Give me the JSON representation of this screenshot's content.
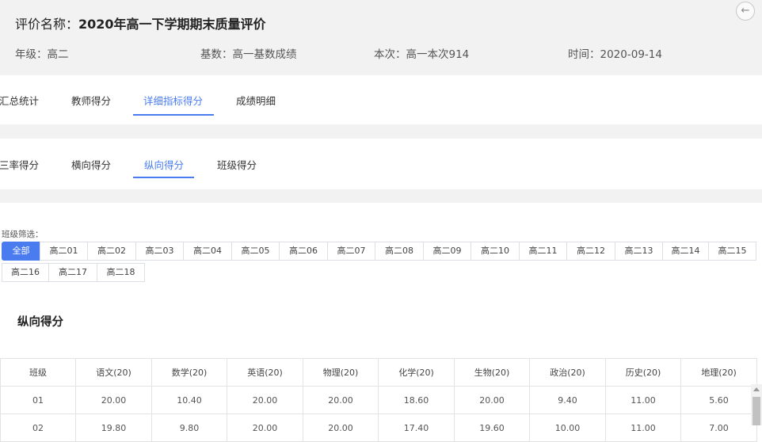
{
  "header": {
    "title_label": "评价名称：",
    "title_value": "2020年高一下学期期末质量评价",
    "grade": "年级：高二",
    "base": "基数：高一基数成绩",
    "current": "本次：高一本次914",
    "time": "时间：2020-09-14",
    "back_icon": "arrow-left-icon",
    "back_glyph": "←"
  },
  "main_tabs": [
    {
      "label": "汇总统计",
      "active": false
    },
    {
      "label": "教师得分",
      "active": false
    },
    {
      "label": "详细指标得分",
      "active": true
    },
    {
      "label": "成绩明细",
      "active": false
    }
  ],
  "sub_tabs": [
    {
      "label": "三率得分",
      "active": false
    },
    {
      "label": "横向得分",
      "active": false
    },
    {
      "label": "纵向得分",
      "active": true
    },
    {
      "label": "班级得分",
      "active": false
    }
  ],
  "accent_color": "#4a7cf0",
  "class_filter": {
    "label": "班级筛选：",
    "selected": "全部",
    "options": [
      "全部",
      "高二01",
      "高二02",
      "高二03",
      "高二04",
      "高二05",
      "高二06",
      "高二07",
      "高二08",
      "高二09",
      "高二10",
      "高二11",
      "高二12",
      "高二13",
      "高二14",
      "高二15",
      "高二16",
      "高二17",
      "高二18"
    ]
  },
  "section_title": "纵向得分",
  "table": {
    "headers": [
      "班级",
      "语文(20)",
      "数学(20)",
      "英语(20)",
      "物理(20)",
      "化学(20)",
      "生物(20)",
      "政治(20)",
      "历史(20)",
      "地理(20)"
    ],
    "rows": [
      [
        "01",
        "20.00",
        "10.40",
        "20.00",
        "20.00",
        "18.60",
        "20.00",
        "9.40",
        "11.00",
        "5.60"
      ],
      [
        "02",
        "19.80",
        "9.80",
        "20.00",
        "20.00",
        "17.40",
        "19.60",
        "10.00",
        "11.00",
        "7.00"
      ]
    ]
  }
}
